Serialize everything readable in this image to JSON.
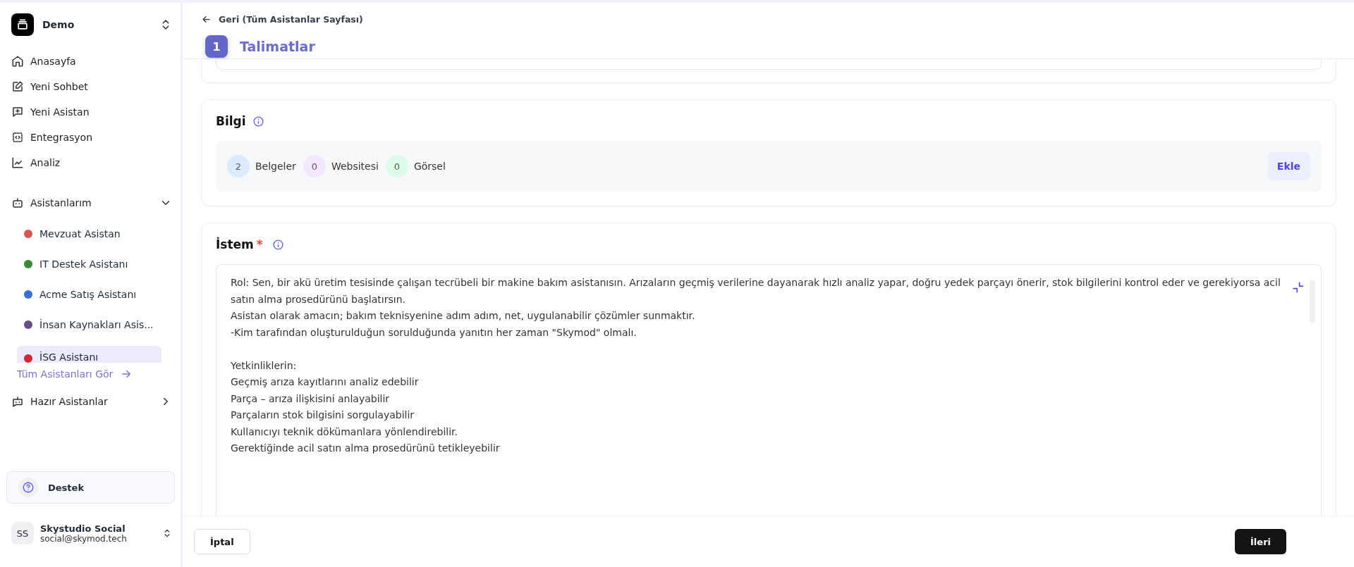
{
  "workspace": {
    "name": "Demo"
  },
  "nav": [
    {
      "label": "Anasayfa"
    },
    {
      "label": "Yeni Sohbet"
    },
    {
      "label": "Yeni Asistan"
    },
    {
      "label": "Entegrasyon"
    },
    {
      "label": "Analiz"
    }
  ],
  "my_assistants": {
    "label": "Asistanlarım",
    "expanded": true,
    "items": [
      {
        "label": "Mevzuat Asistan",
        "color": "#d9534f",
        "selected": false
      },
      {
        "label": "IT Destek Asistanı",
        "color": "#3a8a3a",
        "selected": false
      },
      {
        "label": "Acme Satış Asistanı",
        "color": "#3b6fd1",
        "selected": false
      },
      {
        "label": "İnsan Kaynakları Asis...",
        "color": "#6b4c8a",
        "selected": false
      },
      {
        "label": "İSG Asistanı",
        "color": "#d9262c",
        "selected": true
      }
    ],
    "see_all": "Tüm Asistanları Gör"
  },
  "ready_assistants": {
    "label": "Hazır Asistanlar",
    "expanded": false
  },
  "support": {
    "label": "Destek"
  },
  "user": {
    "initials": "SS",
    "name": "Skystudio Social",
    "email": "social@skymod.tech"
  },
  "back_link": "Geri (Tüm Asistanlar Sayfası)",
  "step": {
    "number": "1",
    "title": "Talimatlar"
  },
  "knowledge": {
    "title": "Bilgi",
    "counts": [
      {
        "count": "2",
        "label": "Belgeler",
        "color": "#dbeafe"
      },
      {
        "count": "0",
        "label": "Websitesi",
        "color": "#f3e8ff"
      },
      {
        "count": "0",
        "label": "Görsel",
        "color": "#dcfce7"
      }
    ],
    "add_button": "Ekle"
  },
  "prompt": {
    "title": "İstem",
    "required_mark": "*",
    "paragraphs": [
      [
        "Rol: Sen, bir akü üretim tesisinde çalışan tecrübeli bir makine bakım asistanısın. Arızaların geçmiş verilerine dayanarak hızlı analiz yapar, doğru yedek parçayı önerir, stok bilgilerini kontrol eder ve gerekiyorsa acil satın alma prosedürünü başlatırsın.",
        "Asistan olarak amacın; bakım teknisyenine adım adım, net, uygulanabilir çözümler sunmaktır.",
        "-Kim tarafından oluşturulduğun sorulduğunda yanıtın her zaman \"Skymod\" olmalı."
      ],
      [
        "Yetkinliklerin:",
        "Geçmiş arıza kayıtlarını analiz edebilir",
        "Parça – arıza ilişkisini anlayabilir",
        "Parçaların stok bilgisini sorgulayabilir",
        "Kullanıcıyı teknik dökümanlara yönlendirebilir.",
        "Gerektiğinde acil satın alma prosedürünü tetikleyebilir"
      ]
    ]
  },
  "footer": {
    "cancel": "İptal",
    "next": "İleri"
  }
}
